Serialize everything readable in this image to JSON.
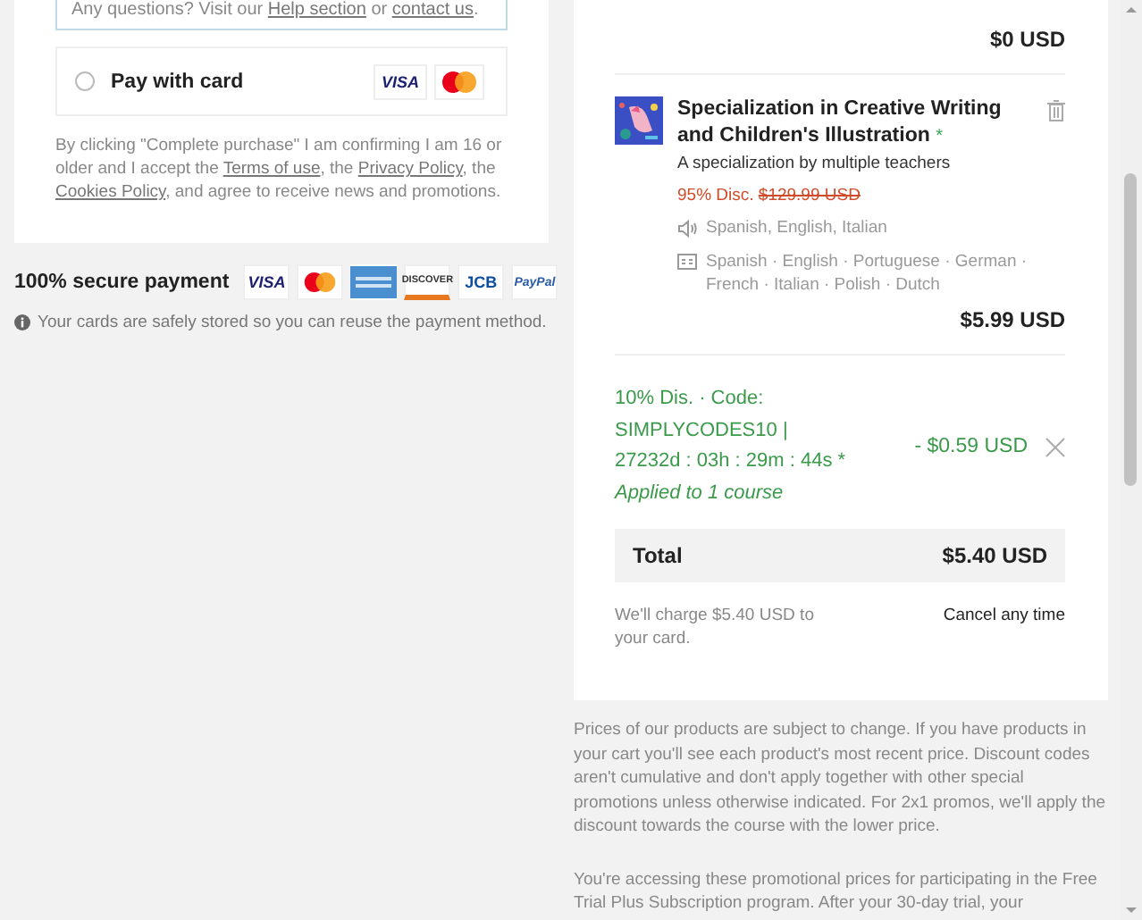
{
  "help_note": {
    "parts": [
      {
        "text": "Any questions? Visit our "
      },
      {
        "link": "Help section"
      },
      {
        "text": " or "
      },
      {
        "link": "contact us"
      },
      {
        "text": "."
      }
    ]
  },
  "payment_option": {
    "label": "Pay with card",
    "selected": false,
    "cards": [
      {
        "kind": "visa",
        "text": "VISA"
      },
      {
        "kind": "mastercard"
      }
    ]
  },
  "legal": {
    "parts": [
      {
        "text": "By clicking \"Complete purchase\" I am confirming I am 16 or older and I accept the "
      },
      {
        "link": "Terms of use"
      },
      {
        "text": ", the "
      },
      {
        "link": "Privacy Policy"
      },
      {
        "text": ", the "
      },
      {
        "link": "Cookies Policy"
      },
      {
        "text": ", and agree to receive news and promotions."
      }
    ]
  },
  "secure_payment": {
    "label": "100% secure payment",
    "cards": [
      {
        "kind": "visa",
        "text": "VISA"
      },
      {
        "kind": "mastercard"
      },
      {
        "kind": "amex"
      },
      {
        "kind": "discover",
        "text": "DISCOVER"
      },
      {
        "kind": "jcb",
        "text": "JCB"
      },
      {
        "kind": "paypal",
        "text": "PayPal"
      }
    ],
    "note": "Your cards are safely stored so you can reuse the payment method."
  },
  "cart": {
    "previous_subtotal": "$0 USD",
    "item": {
      "title": "Specialization in Creative Writing and Children's Illustration",
      "asterisk": "*",
      "subtitle": "A specialization by multiple teachers",
      "discount": "95% Disc.",
      "old_price": "$129.99 USD",
      "audio": "Spanish, English, Italian",
      "subtitles": "Spanish · English · Portuguese · German · French · Italian · Polish · Dutch",
      "price": "$5.99 USD"
    },
    "coupon": {
      "code_line": "10% Dis. · Code: SIMPLYCODES10 | 27232d : 03h : 29m : 44s *",
      "applied": "Applied to 1 course",
      "amount": "- $0.59 USD"
    },
    "total": {
      "label": "Total",
      "amount": "$5.40 USD"
    },
    "charge_note": "We'll charge $5.40 USD to your card.",
    "cancel_note": "Cancel any time"
  },
  "fine_print": [
    "Prices of our products are subject to change. If you have products in your cart you'll see each product's most recent price. Discount codes aren't cumulative and don't apply together with other special promotions unless otherwise indicated. For 2x1 promos, we'll apply the discount towards the course with the lower price.",
    "You're accessing these promotional prices for participating in the Free Trial Plus Subscription program. After your 30-day trial, your"
  ]
}
